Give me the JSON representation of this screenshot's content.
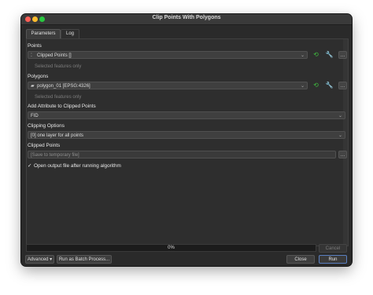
{
  "window": {
    "title": "Clip Points With Polygons"
  },
  "tabs": [
    {
      "label": "Parameters",
      "active": true
    },
    {
      "label": "Log",
      "active": false
    }
  ],
  "points": {
    "label": "Points",
    "value": "Clipped Points []",
    "selected_only": "Selected features only"
  },
  "polygons": {
    "label": "Polygons",
    "value": "polygon_01 [EPSG:4326]",
    "selected_only": "Selected features only"
  },
  "add_attribute": {
    "label": "Add Attribute to Clipped Points",
    "value": "FID"
  },
  "clipping_options": {
    "label": "Clipping Options",
    "value": "[0] one layer for all points"
  },
  "output": {
    "label": "Clipped Points",
    "placeholder": "[Save to temporary file]",
    "open_after_run_label": "Open output file after running algorithm",
    "open_after_run_checked": true
  },
  "progress": {
    "percent_label": "0%",
    "value": 0
  },
  "buttons": {
    "cancel": "Cancel",
    "advanced": "Advanced",
    "batch": "Run as Batch Process...",
    "close": "Close",
    "run": "Run"
  },
  "icons": {
    "iterate": "iterate-icon",
    "settings": "wrench-icon",
    "browse": "ellipsis-icon"
  },
  "colors": {
    "iterate_green": "#3fbd3f",
    "progress_fill": "#4a6fa5",
    "run_border": "#5a7fc0"
  }
}
